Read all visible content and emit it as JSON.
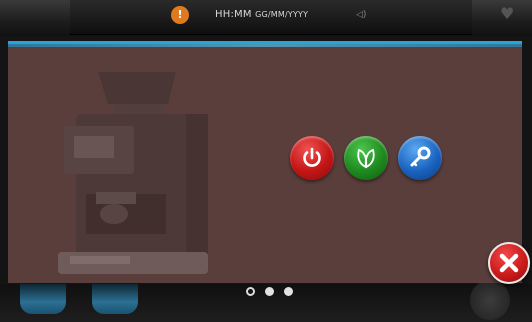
{
  "status_bar": {
    "warning_icon": "warning-icon",
    "time_placeholder": "HH:MM",
    "date_placeholder": "GG/MM/YYYY",
    "volume_icon": "speaker-icon",
    "favorite_icon": "heart-icon"
  },
  "modal": {
    "accent_color": "#2aa3d8",
    "background_color": "#5a3e3b",
    "illustration": "coffee-machine-silhouette",
    "actions": [
      {
        "id": "power",
        "icon": "power-icon",
        "color": "#c41515"
      },
      {
        "id": "eco",
        "icon": "leaf-icon",
        "color": "#1f8a1f"
      },
      {
        "id": "maintenance",
        "icon": "key-icon",
        "color": "#1a63c0"
      }
    ],
    "close_icon": "close-icon",
    "close_color": "#cc1b1b"
  },
  "pager": {
    "count": 3,
    "active_index": 0
  }
}
